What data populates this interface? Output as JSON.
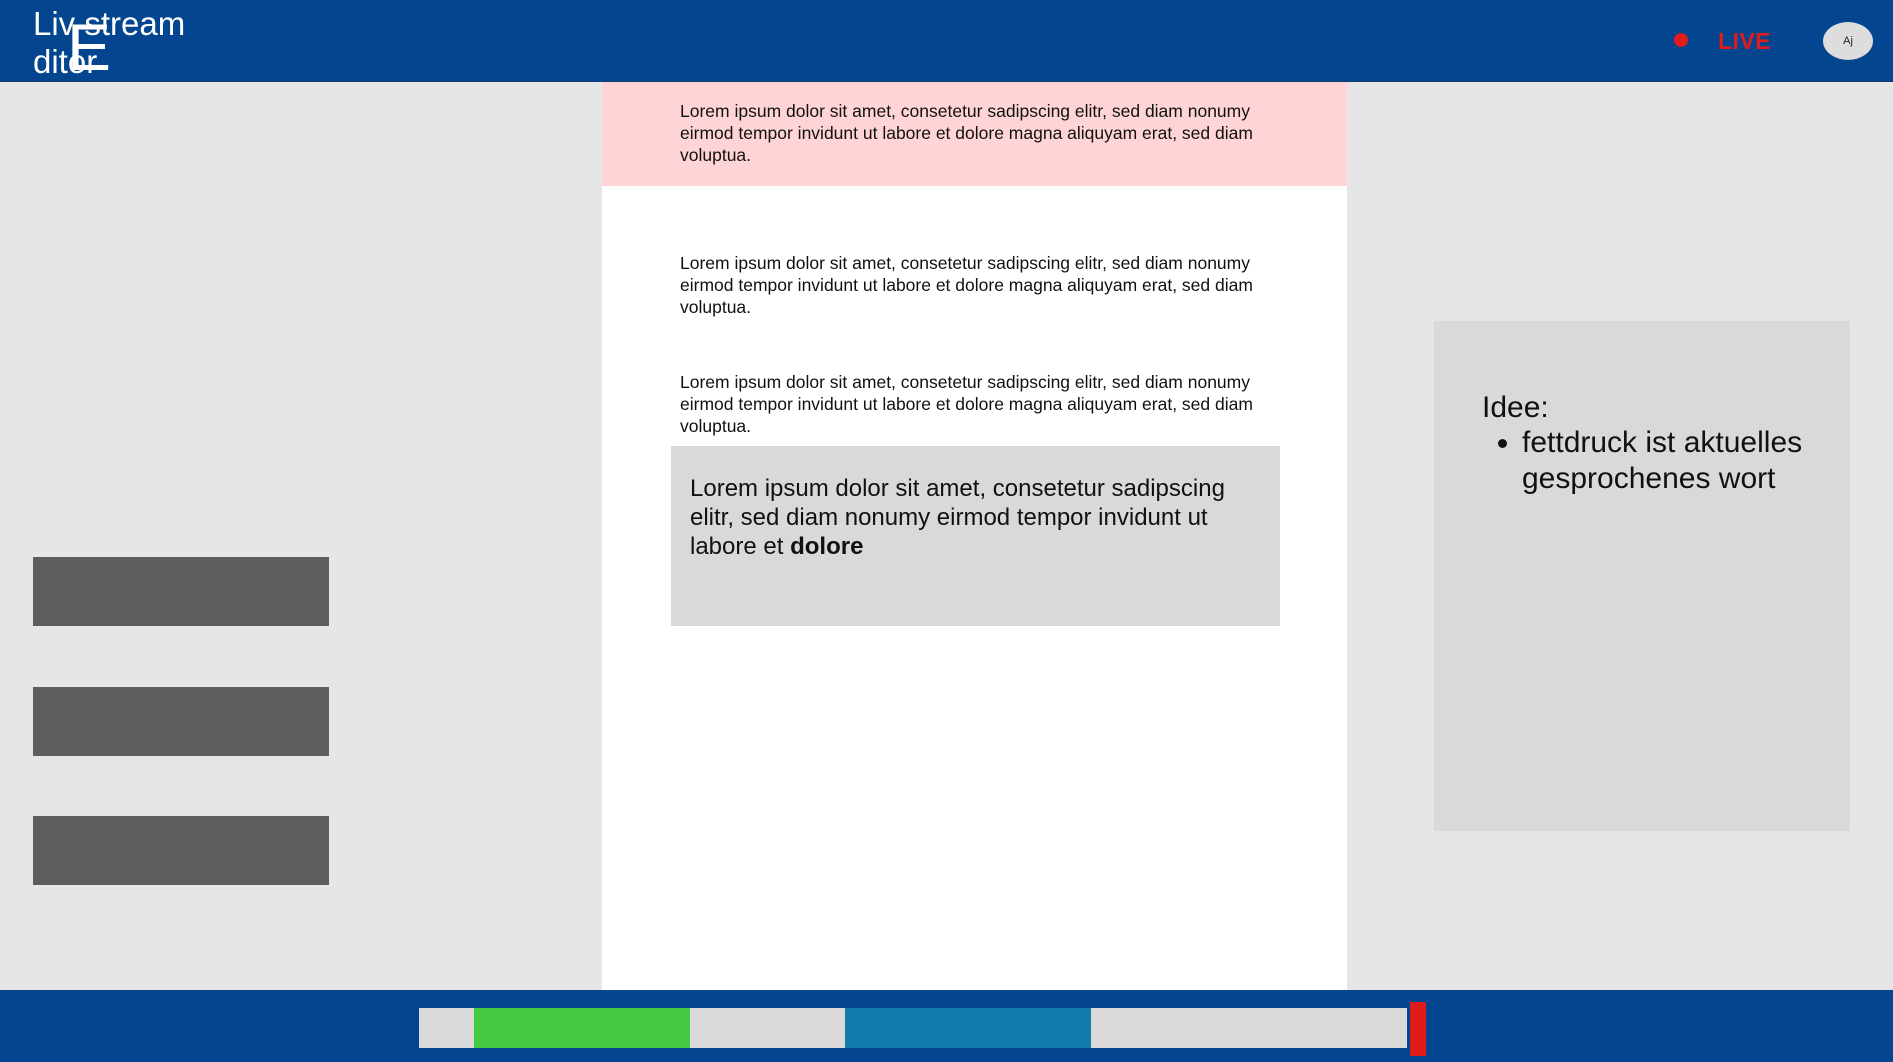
{
  "header": {
    "logo_line1": "Liv stream",
    "logo_line2": " ditor",
    "logo_big_letter": "E",
    "live_label": "LIVE",
    "avatar_initials": "Aj",
    "live_color": "#e01b1b",
    "bar_color": "#03458f"
  },
  "editor": {
    "paragraphs": [
      "Lorem ipsum dolor sit amet, consetetur sadipscing elitr, sed diam nonumy eirmod tempor invidunt ut labore et dolore magna aliquyam erat, sed diam voluptua.",
      "Lorem ipsum dolor sit amet, consetetur sadipscing elitr, sed diam nonumy eirmod tempor invidunt ut labore et dolore magna aliquyam erat, sed diam voluptua.",
      "Lorem ipsum dolor sit amet, consetetur sadipscing elitr, sed diam nonumy eirmod tempor invidunt ut labore et dolore magna aliquyam erat, sed diam voluptua."
    ],
    "current_text": "Lorem ipsum dolor sit amet, consetetur sadipscing elitr, sed diam nonumy eirmod tempor invidunt ut labore et",
    "current_bold_word": "dolore",
    "highlight_color": "#ffd4d6"
  },
  "idea": {
    "heading": "Idee:",
    "items": [
      "fettdruck ist aktuelles gesprochenes wort"
    ]
  },
  "timeline": {
    "segments": [
      {
        "name": "green",
        "color": "#44c940"
      },
      {
        "name": "blue",
        "color": "#127bab"
      }
    ],
    "playhead_color": "#e01b1b"
  }
}
